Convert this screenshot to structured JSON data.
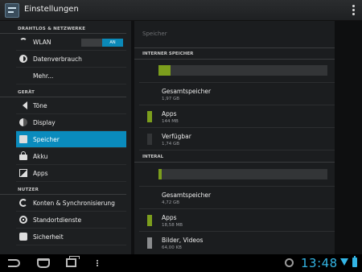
{
  "actionbar": {
    "title": "Einstellungen",
    "icon": "settings-icon",
    "overflow_icon": "overflow-menu-icon"
  },
  "left": {
    "sections": [
      {
        "header": "DRAHTLOS & NETZWERKE"
      },
      {
        "header": "GERÄT"
      },
      {
        "header": "NUTZER"
      }
    ],
    "items": {
      "wlan": {
        "label": "WLAN",
        "icon": "wifi-icon",
        "toggle_state": "AN"
      },
      "datenverbrauch": {
        "label": "Datenverbrauch",
        "icon": "data-usage-icon"
      },
      "mehr": {
        "label": "Mehr..."
      },
      "toene": {
        "label": "Töne",
        "icon": "speaker-icon"
      },
      "display": {
        "label": "Display",
        "icon": "display-icon"
      },
      "speicher": {
        "label": "Speicher",
        "icon": "storage-icon",
        "selected": true
      },
      "akku": {
        "label": "Akku",
        "icon": "battery-icon"
      },
      "apps": {
        "label": "Apps",
        "icon": "apps-icon"
      },
      "konten": {
        "label": "Konten & Synchronisierung",
        "icon": "sync-icon"
      },
      "standort": {
        "label": "Standortdienste",
        "icon": "location-icon"
      },
      "sicherheit": {
        "label": "Sicherheit",
        "icon": "lock-icon"
      }
    }
  },
  "right": {
    "title": "Speicher",
    "internal_storage": {
      "header": "INTERNER SPEICHER",
      "usage_fraction": 0.07,
      "items": [
        {
          "label": "Gesamtspeicher",
          "value": "1,97 GB"
        },
        {
          "label": "Apps",
          "value": "144 MB",
          "color": "#7c9e1d"
        },
        {
          "label": "Verfügbar",
          "value": "1,74 GB",
          "color": "#333537"
        }
      ]
    },
    "interal": {
      "header": "INTERAL",
      "usage_fraction": 0.02,
      "items": [
        {
          "label": "Gesamtspeicher",
          "value": "4,72 GB"
        },
        {
          "label": "Apps",
          "value": "18,58 MB",
          "color": "#7c9e1d"
        },
        {
          "label": "Bilder, Videos",
          "value": "64,00 KB",
          "color": "#8a8c8e"
        }
      ]
    }
  },
  "statusbar": {
    "time": "13:48",
    "accent": "#33b5e5",
    "icons": [
      "back-icon",
      "home-icon",
      "recent-apps-icon",
      "menu-icon",
      "alarm-icon",
      "wifi-signal-icon",
      "battery-icon"
    ]
  }
}
